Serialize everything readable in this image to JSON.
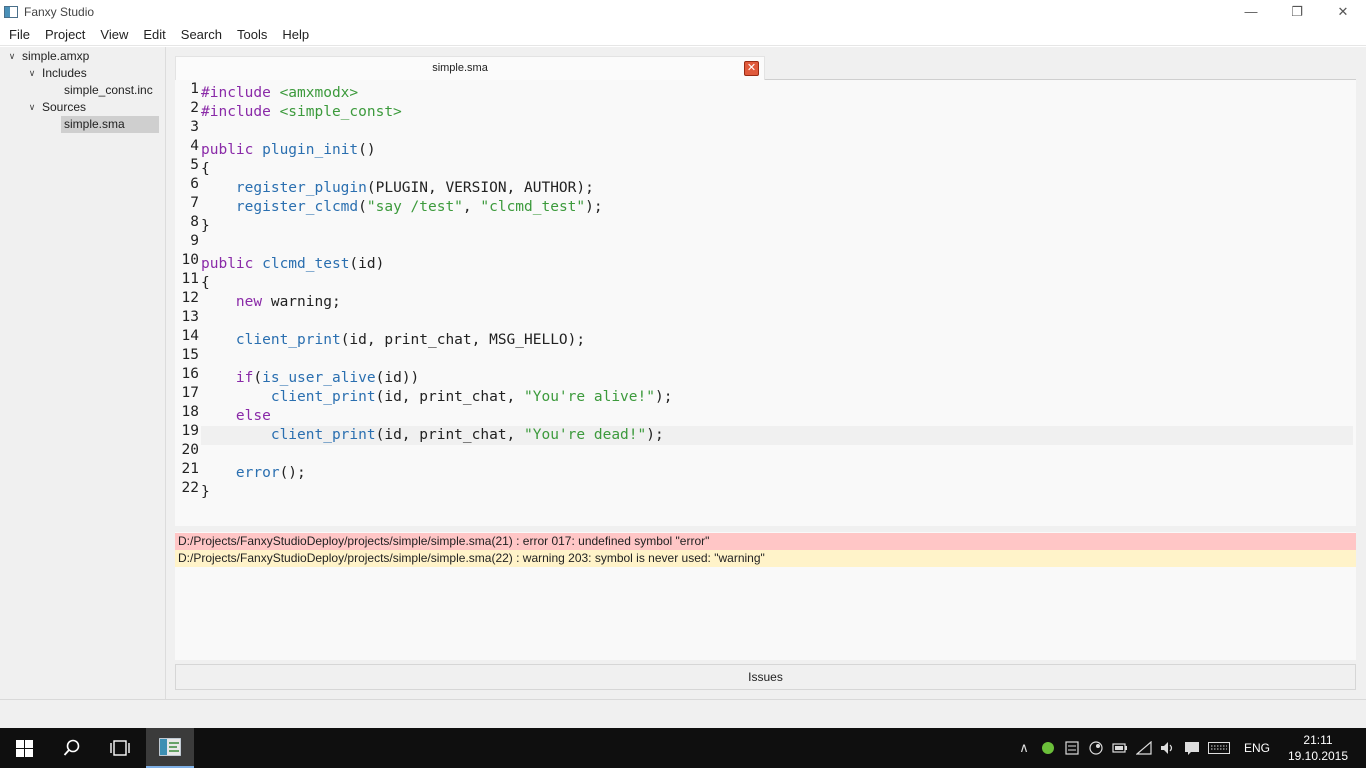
{
  "window": {
    "title": "Fanxy Studio",
    "controls": {
      "minimize": "—",
      "restore": "❐",
      "close": "✕"
    }
  },
  "menubar": {
    "items": [
      "File",
      "Project",
      "View",
      "Edit",
      "Search",
      "Tools",
      "Help"
    ]
  },
  "tree": {
    "root": "simple.amxp",
    "includes_label": "Includes",
    "includes_file": "simple_const.inc",
    "sources_label": "Sources",
    "sources_file": "simple.sma"
  },
  "editor": {
    "tab_label": "simple.sma",
    "tab_close": "✕",
    "current_line": 19,
    "lines": [
      {
        "n": "1"
      },
      {
        "n": "2"
      },
      {
        "n": "3"
      },
      {
        "n": "4"
      },
      {
        "n": "5"
      },
      {
        "n": "6"
      },
      {
        "n": "7"
      },
      {
        "n": "8"
      },
      {
        "n": "9"
      },
      {
        "n": "10"
      },
      {
        "n": "11"
      },
      {
        "n": "12"
      },
      {
        "n": "13"
      },
      {
        "n": "14"
      },
      {
        "n": "15"
      },
      {
        "n": "16"
      },
      {
        "n": "17"
      },
      {
        "n": "18"
      },
      {
        "n": "19"
      },
      {
        "n": "20"
      },
      {
        "n": "21"
      },
      {
        "n": "22"
      }
    ],
    "code": {
      "l1_pre": "#include",
      "l1_inc": " <amxmodx>",
      "l2_pre": "#include",
      "l2_inc": " <simple_const>",
      "l4_kw": "public",
      "l4_fn": " plugin_init",
      "l4_rest": "()",
      "l5": "{",
      "l6_fn": "    register_plugin",
      "l6_rest": "(PLUGIN, VERSION, AUTHOR);",
      "l7_fn": "    register_clcmd",
      "l7_a": "(",
      "l7_s1": "\"say /test\"",
      "l7_b": ", ",
      "l7_s2": "\"clcmd_test\"",
      "l7_c": ");",
      "l8": "}",
      "l10_kw": "public",
      "l10_fn": " clcmd_test",
      "l10_rest": "(id)",
      "l11": "{",
      "l12_kw": "    new",
      "l12_rest": " warning;",
      "l14_fn": "    client_print",
      "l14_rest": "(id, print_chat, MSG_HELLO);",
      "l16_kw": "    if",
      "l16_a": "(",
      "l16_fn": "is_user_alive",
      "l16_rest": "(id))",
      "l17_fn": "        client_print",
      "l17_a": "(id, print_chat, ",
      "l17_s": "\"You're alive!\"",
      "l17_b": ");",
      "l18_kw": "    else",
      "l19_fn": "        client_print",
      "l19_a": "(id, print_chat, ",
      "l19_s": "\"You're dead!\"",
      "l19_b": ");",
      "l21_fn": "    error",
      "l21_rest": "();",
      "l22": "}"
    }
  },
  "issues": {
    "error": "D:/Projects/FanxyStudioDeploy/projects/simple/simple.sma(21) : error 017: undefined symbol \"error\"",
    "warning": "D:/Projects/FanxyStudioDeploy/projects/simple/simple.sma(22) : warning 203: symbol is never used: \"warning\"",
    "button_label": "Issues"
  },
  "taskbar": {
    "tray_lang": "ENG",
    "time": "21:11",
    "date": "19.10.2015"
  },
  "colors": {
    "error_bg": "#ffc6c6",
    "warning_bg": "#fff3c9",
    "keyword": "#8a2aa8",
    "string": "#3c9a3c",
    "function": "#2a6fb0"
  }
}
